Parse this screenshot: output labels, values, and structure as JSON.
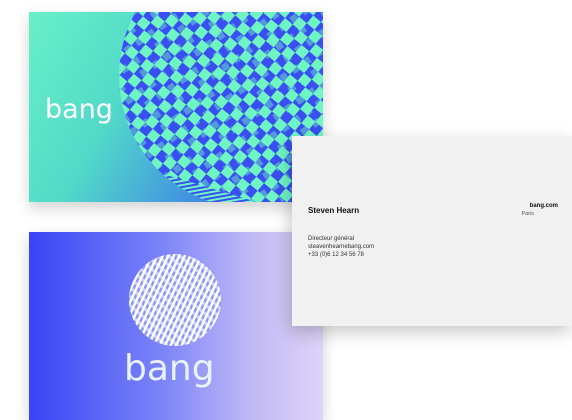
{
  "cards": {
    "top": {
      "brand": "bang"
    },
    "bottom": {
      "brand": "bang"
    },
    "contact": {
      "name": "Steven Hearn",
      "site": "bang.com",
      "city": "Paris",
      "title": "Directeur général",
      "email": "steavenhearnebang.com",
      "phone": "+33 (0)6 12 34 56 78"
    }
  },
  "colors": {
    "card1_start": "#69f0c7",
    "card1_end": "#3b4ff0",
    "card2_start": "#3a44f5",
    "card2_end": "#ddd4f7",
    "pattern_light": "#6ef5c3",
    "pattern_dark": "#3a4ff2"
  }
}
